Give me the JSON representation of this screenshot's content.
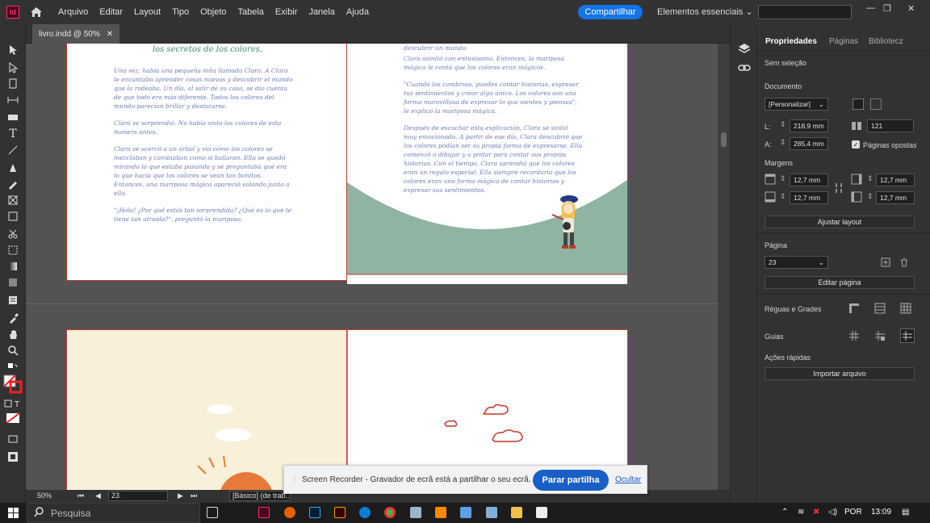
{
  "app": {
    "logo_text": "Id",
    "menu": [
      "Arquivo",
      "Editar",
      "Layout",
      "Tipo",
      "Objeto",
      "Tabela",
      "Exibir",
      "Janela",
      "Ajuda"
    ],
    "share_label": "Compartilhar",
    "workspace_label": "Elementos essenciais"
  },
  "document": {
    "tab_label": "livro.indd @ 50%",
    "title_text": "los secretos de los colores.",
    "left_page_paragraphs": [
      "Una vez, había una pequeña niña llamada Clara. A Clara le encantaba aprender cosas nuevas y descubrir el mundo que la rodeaba. Un día, al salir de su casa, se dio cuenta de que todo era más diferente. Todos los colores del mundo parecían brillar y destacarse.",
      "Clara se sorprendió. No había visto los colores de esta manera antes.",
      "Clara se acercó a un árbol y vio cómo los colores se mezclaban y cambiaban como si bailaran. Ella se quedó mirando lo que estaba pasando y se preguntaba qué era lo que hacía que los colores se vean tan bonitos. Entonces, una mariposa mágica apareció volando junto a ella.",
      "\"¡Hola! ¿Por qué estás tan sorprendida? ¿Qué es lo que te tiene tan atraída?\", preguntó la mariposa."
    ],
    "right_page_paragraphs": [
      "descubrir un mundo.",
      "Clara asintió con entusiasmo. Entonces, la mariposa mágica le contó que los colores eran mágicos.",
      "\"Cuando los combinas, puedes contar historias, expresar tus sentimientos y crear algo único. Los colores son una forma maravillosa de expresar lo que sientes y piensas\", le explicó la mariposa mágica.",
      "Después de escuchar esta explicación, Clara se sintió muy emocionada. A partir de ese día, Clara descubrió que los colores podían ser su propia forma de expresarse. Ella comenzó a dibujar y a pintar para contar sus propias historias. Con el tiempo, Clara aprendió que los colores eran un regalo especial. Ella siempre recordaría que los colores eran una forma mágica de contar historias y expresar sus sentimientos."
    ]
  },
  "status": {
    "zoom": "50%",
    "page": "23",
    "style": "[Básico] (de trab..."
  },
  "panel": {
    "tabs": [
      "Propriedades",
      "Páginas",
      "Bibliotecz"
    ],
    "no_selection": "Sem seleção",
    "documento_label": "Documento",
    "preset": "[Personalizar]",
    "width_label": "L:",
    "width_value": "218,9 mm",
    "height_label": "A:",
    "height_value": "285,4 mm",
    "pages_count": "121",
    "facing_pages_label": "Páginas opostas",
    "margins_label": "Margens",
    "margin_top": "12,7 mm",
    "margin_bottom": "12,7 mm",
    "margin_inside": "12,7 mm",
    "margin_outside": "12,7 mm",
    "adjust_layout": "Ajustar layout",
    "page_label": "Página",
    "page_value": "23",
    "edit_page": "Editar página",
    "rulers_label": "Réguas e Grades",
    "guides_label": "Guias",
    "quick_actions_label": "Ações rápidas",
    "import_file": "Importar arquivo"
  },
  "notification": {
    "text": "Screen Recorder - Gravador de ecrã está a partilhar o seu ecrã.",
    "stop_button": "Parar partilha",
    "hide_link": "Ocultar"
  },
  "taskbar": {
    "search_placeholder": "Pesquisa",
    "language": "POR",
    "time": "13:09"
  },
  "colors": {
    "accent_blue": "#1473e6",
    "indesign_pink": "#ff3366",
    "hill_green": "#8fb5a2",
    "page_border_red": "#c0392b"
  }
}
